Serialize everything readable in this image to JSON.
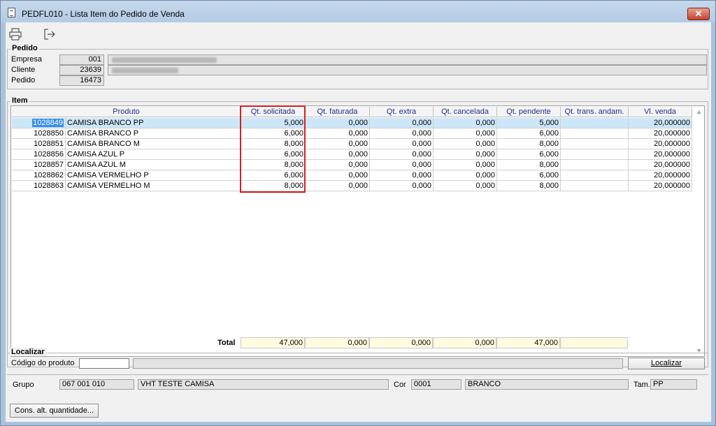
{
  "window": {
    "title": "PEDFL010 - Lista Item do Pedido de Venda",
    "close": "✕"
  },
  "toolbar": {
    "print_icon": "printer-icon",
    "exit_icon": "exit-icon"
  },
  "pedido": {
    "title": "Pedido",
    "empresa_label": "Empresa",
    "empresa_value": "001",
    "cliente_label": "Cliente",
    "cliente_value": "23639",
    "pedido_label": "Pedido",
    "pedido_value": "16473"
  },
  "item": {
    "title": "Item",
    "columns": [
      "Produto",
      "Qt. solicitada",
      "Qt. faturada",
      "Qt. extra",
      "Qt. cancelada",
      "Qt. pendente",
      "Qt. trans. andam.",
      "Vl. venda"
    ],
    "rows": [
      {
        "code": "1028849",
        "name": "CAMISA BRANCO PP",
        "sol": "5,000",
        "fat": "0,000",
        "ext": "0,000",
        "can": "0,000",
        "pen": "5,000",
        "tra": "",
        "vl": "20,000000"
      },
      {
        "code": "1028850",
        "name": "CAMISA BRANCO P",
        "sol": "6,000",
        "fat": "0,000",
        "ext": "0,000",
        "can": "0,000",
        "pen": "6,000",
        "tra": "",
        "vl": "20,000000"
      },
      {
        "code": "1028851",
        "name": "CAMISA BRANCO M",
        "sol": "8,000",
        "fat": "0,000",
        "ext": "0,000",
        "can": "0,000",
        "pen": "8,000",
        "tra": "",
        "vl": "20,000000"
      },
      {
        "code": "1028856",
        "name": "CAMISA AZUL P",
        "sol": "6,000",
        "fat": "0,000",
        "ext": "0,000",
        "can": "0,000",
        "pen": "6,000",
        "tra": "",
        "vl": "20,000000"
      },
      {
        "code": "1028857",
        "name": "CAMISA AZUL M",
        "sol": "8,000",
        "fat": "0,000",
        "ext": "0,000",
        "can": "0,000",
        "pen": "8,000",
        "tra": "",
        "vl": "20,000000"
      },
      {
        "code": "1028862",
        "name": "CAMISA VERMELHO P",
        "sol": "6,000",
        "fat": "0,000",
        "ext": "0,000",
        "can": "0,000",
        "pen": "6,000",
        "tra": "",
        "vl": "20,000000"
      },
      {
        "code": "1028863",
        "name": "CAMISA VERMELHO M",
        "sol": "8,000",
        "fat": "0,000",
        "ext": "0,000",
        "can": "0,000",
        "pen": "8,000",
        "tra": "",
        "vl": "20,000000"
      }
    ],
    "total_label": "Total",
    "totals": {
      "sol": "47,000",
      "fat": "0,000",
      "ext": "0,000",
      "can": "0,000",
      "pen": "47,000",
      "tra": ""
    }
  },
  "localizar": {
    "title": "Localizar",
    "codigo_label": "Código do produto",
    "codigo_value": "",
    "button": "Localizar"
  },
  "info": {
    "grupo_label": "Grupo",
    "grupo_code": "067 001 010",
    "grupo_name": "VHT TESTE CAMISA",
    "cor_label": "Cor",
    "cor_code": "0001",
    "cor_name": "BRANCO",
    "tam_label": "Tam.",
    "tam_value": "PP"
  },
  "footer": {
    "button": "Cons. alt. quantidade..."
  },
  "colors": {
    "highlight": "#d62020",
    "selection": "#cde6f7",
    "total_bg": "#fffbe0"
  }
}
